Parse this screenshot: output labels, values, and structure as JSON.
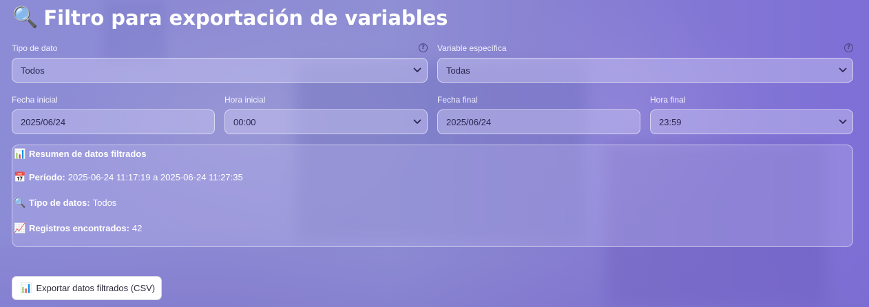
{
  "title": {
    "icon": "🔍",
    "text": "Filtro para exportación de variables"
  },
  "filters": {
    "data_type": {
      "label": "Tipo de dato",
      "value": "Todos",
      "help_icon": "?"
    },
    "variable": {
      "label": "Variable específica",
      "value": "Todas",
      "help_icon": "?"
    },
    "start_date": {
      "label": "Fecha inicial",
      "value": "2025/06/24"
    },
    "start_time": {
      "label": "Hora inicial",
      "value": "00:00"
    },
    "end_date": {
      "label": "Fecha final",
      "value": "2025/06/24"
    },
    "end_time": {
      "label": "Hora final",
      "value": "23:59"
    }
  },
  "summary": {
    "heading_icon": "📊",
    "heading": "Resumen de datos filtrados",
    "period_icon": "📅",
    "period_label": "Período:",
    "period_value": "2025-06-24 11:17:19 a 2025-06-24 11:27:35",
    "type_icon": "🔍",
    "type_label": "Tipo de datos:",
    "type_value": "Todos",
    "records_icon": "📈",
    "records_label": "Registros encontrados:",
    "records_value": "42"
  },
  "export_button": {
    "icon": "📊",
    "label": "Exportar datos filtrados (CSV)"
  },
  "colors": {
    "accent_bg": "#8c8cd6",
    "control_text": "#2a2650"
  }
}
